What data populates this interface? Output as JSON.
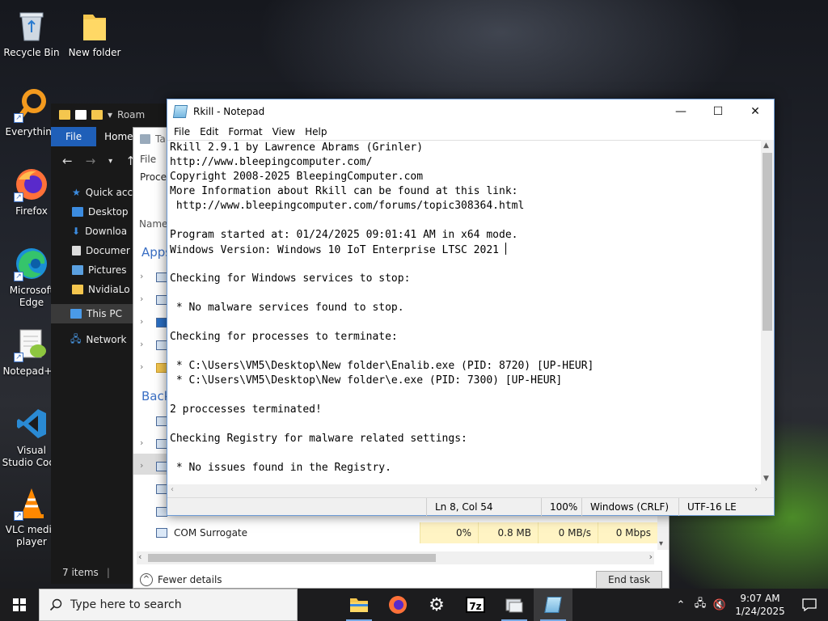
{
  "desktop": {
    "icons": [
      {
        "label": "Recycle Bin",
        "icon": "recycle-bin-icon"
      },
      {
        "label": "New folder",
        "icon": "folder-icon"
      },
      {
        "label": "Everything",
        "icon": "everything-search-icon"
      },
      {
        "label": "Firefox",
        "icon": "firefox-icon"
      },
      {
        "label": "Microsoft Edge",
        "icon": "edge-icon"
      },
      {
        "label": "Notepad++",
        "icon": "notepad-plus-plus-icon"
      },
      {
        "label": "Visual Studio Code",
        "icon": "vscode-icon"
      },
      {
        "label": "VLC media player",
        "icon": "vlc-icon"
      }
    ]
  },
  "explorer": {
    "title": "Roam",
    "tabs": {
      "file": "File",
      "home": "Home"
    },
    "nav": [
      {
        "label": "Quick acce",
        "icon": "star-icon"
      },
      {
        "label": "Desktop",
        "icon": "desktop-icon"
      },
      {
        "label": "Downloa",
        "icon": "download-icon"
      },
      {
        "label": "Documer",
        "icon": "documents-icon"
      },
      {
        "label": "Pictures",
        "icon": "pictures-icon"
      },
      {
        "label": "NvidiaLo",
        "icon": "folder-icon"
      },
      {
        "label": "This PC",
        "icon": "computer-icon"
      },
      {
        "label": "Network",
        "icon": "network-icon"
      }
    ],
    "status": "7 items"
  },
  "taskmgr": {
    "title": "Ta",
    "menu": "File",
    "tab": "Proces",
    "name_header": "Name",
    "apps_header": "Apps",
    "background_header": "Back",
    "visible_row": {
      "name": "COM Surrogate",
      "cpu": "0%",
      "memory": "0.8 MB",
      "disk": "0 MB/s",
      "network": "0 Mbps"
    },
    "fewer_details": "Fewer details",
    "end_task": "End task"
  },
  "notepad": {
    "title": "Rkill - Notepad",
    "menu": [
      "File",
      "Edit",
      "Format",
      "View",
      "Help"
    ],
    "lines": [
      "Rkill 2.9.1 by Lawrence Abrams (Grinler)",
      "http://www.bleepingcomputer.com/",
      "Copyright 2008-2025 BleepingComputer.com",
      "More Information about Rkill can be found at this link:",
      " http://www.bleepingcomputer.com/forums/topic308364.html",
      "",
      "Program started at: 01/24/2025 09:01:41 AM in x64 mode.",
      "Windows Version: Windows 10 IoT Enterprise LTSC 2021 ",
      "",
      "Checking for Windows services to stop:",
      "",
      " * No malware services found to stop.",
      "",
      "Checking for processes to terminate:",
      "",
      " * C:\\Users\\VM5\\Desktop\\New folder\\Enalib.exe (PID: 8720) [UP-HEUR]",
      " * C:\\Users\\VM5\\Desktop\\New folder\\e.exe (PID: 7300) [UP-HEUR]",
      "",
      "2 proccesses terminated!",
      "",
      "Checking Registry for malware related settings:",
      "",
      " * No issues found in the Registry."
    ],
    "status": {
      "position": "Ln 8, Col 54",
      "zoom": "100%",
      "line_ending": "Windows (CRLF)",
      "encoding": "UTF-16 LE"
    }
  },
  "taskbar": {
    "search_placeholder": "Type here to search",
    "apps": [
      "file-explorer-icon",
      "firefox-icon",
      "settings-gear-icon",
      "7zip-icon",
      "rkill-icon",
      "notepad-icon"
    ],
    "time": "9:07 AM",
    "date": "1/24/2025"
  },
  "colors": {
    "accent": "#1f5fb8",
    "taskbar": "#1c1c1e",
    "selection_yellow": "#fff4c4"
  }
}
